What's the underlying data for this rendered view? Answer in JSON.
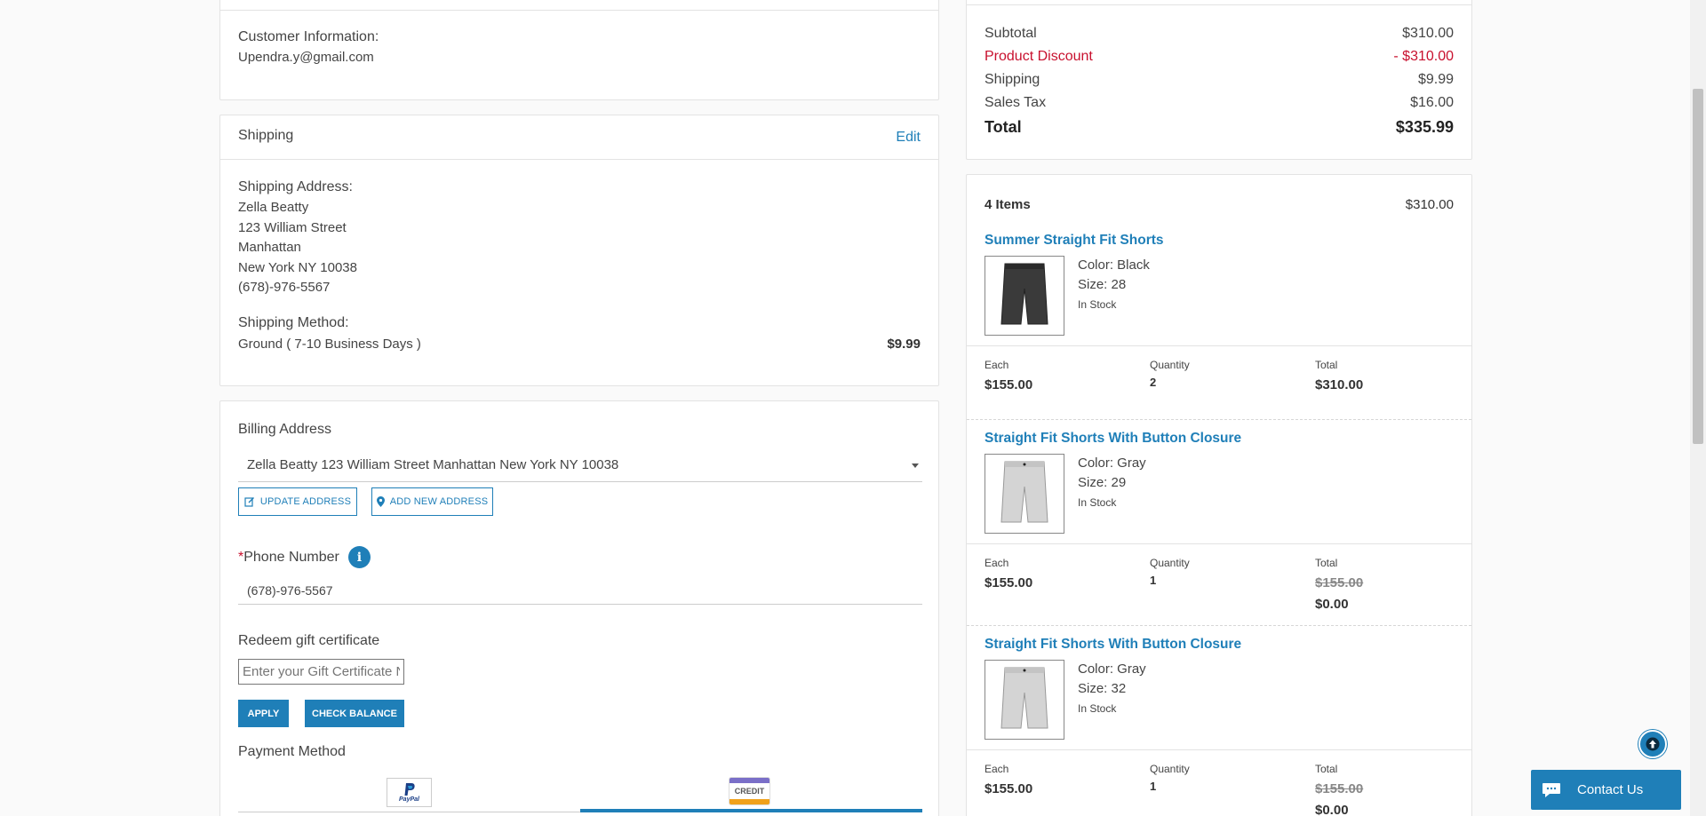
{
  "customer": {
    "label": "Customer Information:",
    "email": "Upendra.y@gmail.com"
  },
  "shipping": {
    "title": "Shipping",
    "edit_label": "Edit",
    "address_label": "Shipping Address:",
    "address_lines": [
      "Zella Beatty",
      "123 William Street",
      "Manhattan",
      "New York NY 10038",
      "(678)-976-5567"
    ],
    "method_label": "Shipping Method:",
    "method": "Ground ( 7-10 Business Days )",
    "method_price": "$9.99"
  },
  "billing": {
    "title": "Billing Address",
    "selected_address": "Zella Beatty 123 William Street Manhattan New York NY 10038",
    "update_btn": "UPDATE ADDRESS",
    "add_btn": "ADD NEW ADDRESS",
    "phone_required": "*",
    "phone_label": "Phone Number",
    "info_glyph": "i",
    "phone_value": "(678)-976-5567",
    "gift_label": "Redeem gift certificate",
    "gift_placeholder": "Enter your Gift Certificate Number",
    "apply_btn": "APPLY",
    "check_btn": "CHECK BALANCE",
    "payment_label": "Payment Method",
    "paypal_text": "PayPal",
    "credit_text": "CREDIT"
  },
  "summary": {
    "subtotal_label": "Subtotal",
    "subtotal": "$310.00",
    "discount_label": "Product Discount",
    "discount": "- $310.00",
    "shipping_label": "Shipping",
    "shipping": "$9.99",
    "tax_label": "Sales Tax",
    "tax": "$16.00",
    "total_label": "Total",
    "total": "$335.99"
  },
  "cart": {
    "count_label": "4 Items",
    "count_total": "$310.00",
    "each_label": "Each",
    "qty_label": "Quantity",
    "total_label": "Total",
    "items": [
      {
        "name": "Summer Straight Fit Shorts",
        "color": "Color: Black",
        "size": "Size: 28",
        "stock": "In Stock",
        "each": "$155.00",
        "qty": "2",
        "total": "$310.00",
        "orig_total": "",
        "swatch": "#3a3a3a"
      },
      {
        "name": "Straight Fit Shorts With Button Closure",
        "color": "Color: Gray",
        "size": "Size: 29",
        "stock": "In Stock",
        "each": "$155.00",
        "qty": "1",
        "total": "$0.00",
        "orig_total": "$155.00",
        "swatch": "#d4d4d4"
      },
      {
        "name": "Straight Fit Shorts With Button Closure",
        "color": "Color: Gray",
        "size": "Size: 32",
        "stock": "In Stock",
        "each": "$155.00",
        "qty": "1",
        "total": "$0.00",
        "orig_total": "$155.00",
        "swatch": "#d4d4d4"
      }
    ]
  },
  "contact": {
    "label": "Contact Us"
  },
  "colors": {
    "accent": "#1f7fb8",
    "discount": "#c8102e"
  }
}
